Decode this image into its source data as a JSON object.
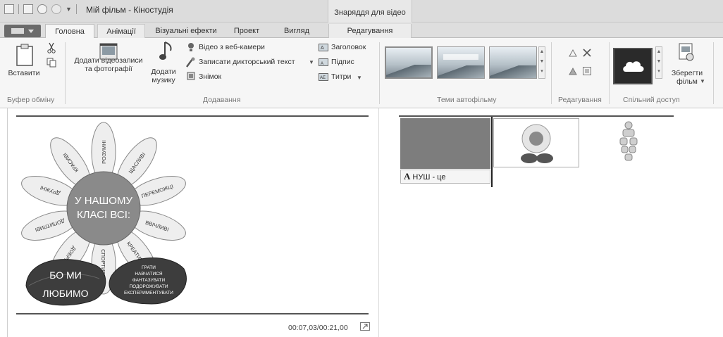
{
  "window": {
    "title": "Мій фільм - Кіностудія",
    "contextual_tools_label": "Знаряддя для відео"
  },
  "tabs": [
    {
      "label": "Головна"
    },
    {
      "label": "Анімації"
    },
    {
      "label": "Візуальні ефекти"
    },
    {
      "label": "Проект"
    },
    {
      "label": "Вигляд"
    },
    {
      "label": "Редагування"
    }
  ],
  "ribbon": {
    "clipboard": {
      "paste_label": "Вставити",
      "group_label": "Буфер обміну"
    },
    "add": {
      "add_videos_photos_label": "Додати відеозаписи та фотографії",
      "add_music_label": "Додати музику",
      "webcam_video_label": "Відео з веб-камери",
      "record_narration_label": "Записати дикторський текст",
      "snapshot_label": "Знімок",
      "title_label": "Заголовок",
      "caption_label": "Підпис",
      "credits_label": "Титри",
      "group_label": "Додавання"
    },
    "themes": {
      "group_label": "Теми автофільму"
    },
    "editing": {
      "group_label": "Редагування"
    },
    "share": {
      "save_movie_label": "Зберегти фільм",
      "group_label": "Спільний доступ"
    }
  },
  "preview": {
    "time": "00:07,03/00:21,00",
    "flower_center_text": "У НАШОМУ КЛАСІ ВСІ:",
    "petals": [
      "РОЗУМНІ",
      "ЩАСЛИВІ",
      "ПЕРЕМОЖЦІ",
      "ВВІЧЛИВІ",
      "КРЕАТИВНІ",
      "СПОРТИВНІ",
      "ДОБРІ",
      "ДОПИТЛИВІ",
      "ДРУЖНІ",
      "КРАСИВІ"
    ],
    "left_leaf_text": "БО МИ ЛЮБИМО",
    "right_leaf_text": "ГРАТИ НАВЧАТИСЯ ФАНТАЗУВАТИ ПОДОРОЖУВАТИ ЕКСПЕРИМЕНТУВАТИ"
  },
  "storyboard": {
    "caption_text": "НУШ - це"
  },
  "colors": {
    "titlebar": "#dcdcdc",
    "ribbon": "#f6f6f6",
    "leaf_dark": "#3d3d3d",
    "petal": "#eeeeee",
    "center": "#8a8a8a"
  }
}
